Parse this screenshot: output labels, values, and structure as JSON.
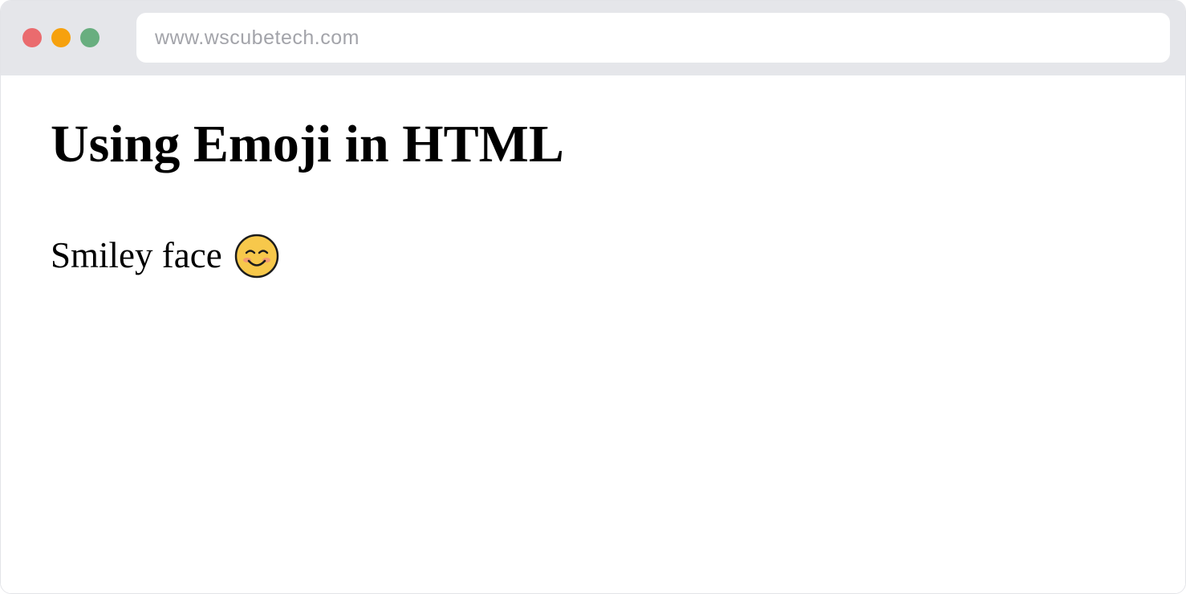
{
  "browser": {
    "url": "www.wscubetech.com",
    "controls": [
      "close",
      "minimize",
      "maximize"
    ]
  },
  "page": {
    "heading": "Using Emoji in HTML",
    "paragraph_text": "Smiley face",
    "emoji": {
      "name": "smiling-face-with-smiling-eyes",
      "character": "😊"
    }
  },
  "colors": {
    "titlebar": "#e5e6ea",
    "close": "#ea6b6e",
    "minimize": "#f6a10e",
    "maximize": "#68ae7f",
    "url_text": "#a3a4aa",
    "emoji_fill": "#f7c84b"
  }
}
